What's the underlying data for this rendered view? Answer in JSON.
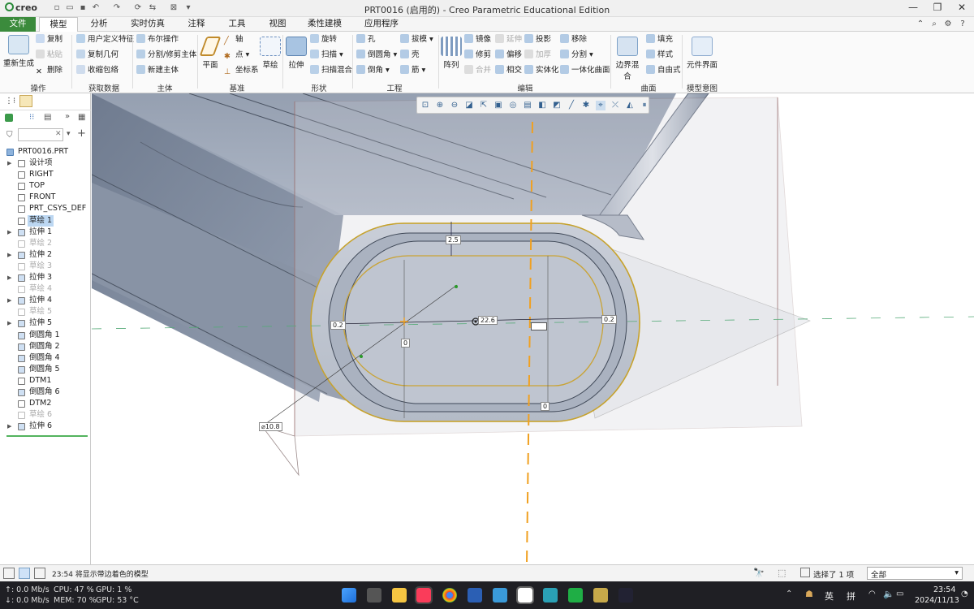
{
  "app": {
    "logo": "creo",
    "window_title": "PRT0016 (启用的) - Creo Parametric Educational Edition"
  },
  "tabs": [
    "文件",
    "模型",
    "分析",
    "实时仿真",
    "注释",
    "工具",
    "视图",
    "柔性建模",
    "应用程序"
  ],
  "ribbon": {
    "operations": {
      "regen": "重新生成",
      "copy": "复制",
      "paste": "粘贴",
      "delete": "删除",
      "group": "操作"
    },
    "get_data": {
      "udf": "用户定义特征",
      "copy_geom": "复制几何",
      "shrinkwrap": "收缩包络",
      "group": "获取数据"
    },
    "body": {
      "boolean": "布尔操作",
      "split": "分割/修剪主体",
      "new_body": "新建主体",
      "group": "主体"
    },
    "datum": {
      "plane": "平面",
      "axis": "轴",
      "point": "点",
      "csys": "坐标系",
      "sketch": "草绘",
      "group": "基准"
    },
    "shapes": {
      "extrude": "拉伸",
      "revolve": "旋转",
      "sweep": "扫描",
      "swept_blend": "扫描混合",
      "group": "形状"
    },
    "engineering": {
      "hole": "孔",
      "draft": "拔模",
      "round": "倒圆角",
      "shell": "壳",
      "chamfer": "倒角",
      "rib": "筋",
      "group": "工程"
    },
    "editing": {
      "pattern": "阵列",
      "mirror": "镜像",
      "extend": "延伸",
      "project": "投影",
      "move": "移除",
      "trim": "修剪",
      "offset": "偏移",
      "thicken": "加厚",
      "split": "分割",
      "merge": "合并",
      "intersect": "相交",
      "solidify": "实体化",
      "unify": "一体化曲面",
      "group": "编辑"
    },
    "surfaces": {
      "boundary_blend": "边界混合",
      "fill": "填充",
      "style": "样式",
      "freestyle": "自由式",
      "group": "曲面"
    },
    "model_intent": {
      "component_interface": "元件界面",
      "group": "模型意图"
    }
  },
  "tree": {
    "filter_placeholder": "",
    "root": "PRT0016.PRT",
    "items": [
      {
        "label": "设计项",
        "state": "normal"
      },
      {
        "label": "RIGHT",
        "state": "normal"
      },
      {
        "label": "TOP",
        "state": "normal"
      },
      {
        "label": "FRONT",
        "state": "normal"
      },
      {
        "label": "PRT_CSYS_DEF",
        "state": "normal"
      },
      {
        "label": "草绘 1",
        "state": "selected"
      },
      {
        "label": "拉伸 1",
        "state": "normal"
      },
      {
        "label": "草绘 2",
        "state": "suppressed"
      },
      {
        "label": "拉伸 2",
        "state": "normal"
      },
      {
        "label": "草绘 3",
        "state": "suppressed"
      },
      {
        "label": "拉伸 3",
        "state": "normal"
      },
      {
        "label": "草绘 4",
        "state": "suppressed"
      },
      {
        "label": "拉伸 4",
        "state": "normal"
      },
      {
        "label": "草绘 5",
        "state": "suppressed"
      },
      {
        "label": "拉伸 5",
        "state": "normal"
      },
      {
        "label": "倒圆角 1",
        "state": "normal"
      },
      {
        "label": "倒圆角 2",
        "state": "normal"
      },
      {
        "label": "倒圆角 4",
        "state": "normal"
      },
      {
        "label": "倒圆角 5",
        "state": "normal"
      },
      {
        "label": "DTM1",
        "state": "normal"
      },
      {
        "label": "倒圆角 6",
        "state": "normal"
      },
      {
        "label": "DTM2",
        "state": "normal"
      },
      {
        "label": "草绘 6",
        "state": "suppressed"
      },
      {
        "label": "拉伸 6",
        "state": "normal"
      }
    ]
  },
  "viewport": {
    "dims": {
      "d1": "2.5",
      "d2": "22.6",
      "d3": "0",
      "d4": "0.2",
      "d5": "0.2",
      "d6": "0",
      "d7": "⌀10.8"
    }
  },
  "status": {
    "message": "23:54  将显示带边着色的模型",
    "selected": "选择了 1 项",
    "filter": "全部"
  },
  "taskbar": {
    "net_up": "↑: 0.0 Mb/s",
    "net_down": "↓: 0.0 Mb/s",
    "cpu": "CPU: 47 %",
    "gpu": "GPU: 1 %",
    "mem": "MEM: 70 %",
    "gpu_temp": "GPU: 53 °C",
    "ime1": "英",
    "ime2": "拼",
    "time": "23:54",
    "date": "2024/11/13"
  }
}
